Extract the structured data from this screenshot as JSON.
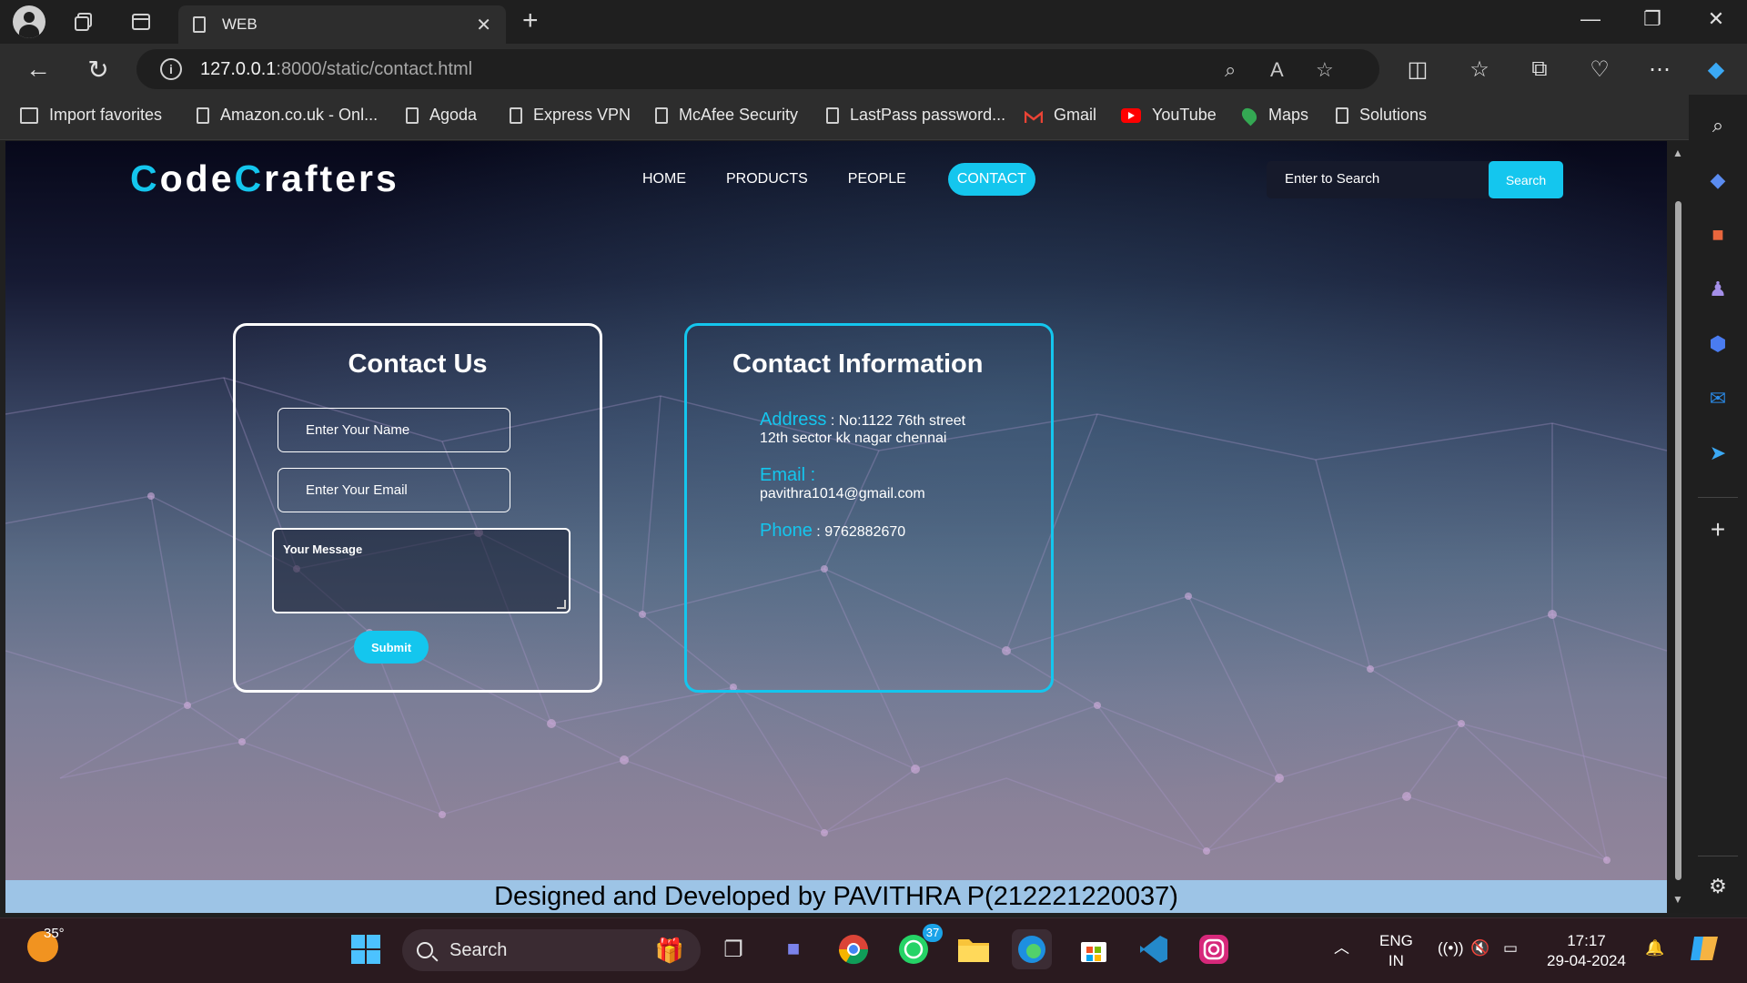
{
  "browser": {
    "tab_title": "WEB",
    "url_host": "127.0.0.1",
    "url_path": ":8000/static/contact.html",
    "favorites": [
      {
        "label": "Import favorites",
        "icon": "import-favorites-icon"
      },
      {
        "label": "Amazon.co.uk - Onl...",
        "icon": "page-icon"
      },
      {
        "label": "Agoda",
        "icon": "page-icon"
      },
      {
        "label": "Express VPN",
        "icon": "page-icon"
      },
      {
        "label": "McAfee Security",
        "icon": "page-icon"
      },
      {
        "label": "LastPass password...",
        "icon": "page-icon"
      },
      {
        "label": "Gmail",
        "icon": "gmail-icon"
      },
      {
        "label": "YouTube",
        "icon": "youtube-icon"
      },
      {
        "label": "Maps",
        "icon": "maps-icon"
      },
      {
        "label": "Solutions",
        "icon": "page-icon"
      }
    ]
  },
  "site": {
    "logo_parts": [
      "C",
      "ode",
      "C",
      "rafters"
    ],
    "nav": [
      "HOME",
      "PRODUCTS",
      "PEOPLE",
      "CONTACT"
    ],
    "active_nav": "CONTACT",
    "search_placeholder": "Enter to Search",
    "search_button": "Search"
  },
  "contact_form": {
    "title": "Contact Us",
    "name_placeholder": "Enter Your Name",
    "email_placeholder": "Enter Your Email",
    "message_placeholder": "Your Message",
    "submit_label": "Submit"
  },
  "contact_info": {
    "title": "Contact Information",
    "address_label": "Address",
    "address_line1": "No:1122 76th street",
    "address_line2": "12th sector kk nagar chennai",
    "email_label": "Email",
    "email_value": "pavithra1014@gmail.com",
    "phone_label": "Phone",
    "phone_value": "9762882670"
  },
  "footer": "Designed and Developed by PAVITHRA P(212221220037)",
  "taskbar": {
    "temperature": "35°",
    "search_label": "Search",
    "whatsapp_badge": "37",
    "lang_line1": "ENG",
    "lang_line2": "IN",
    "time": "17:17",
    "date": "29-04-2024"
  },
  "colors": {
    "accent": "#14c6ee",
    "footer_bg": "#9dc4e6"
  }
}
